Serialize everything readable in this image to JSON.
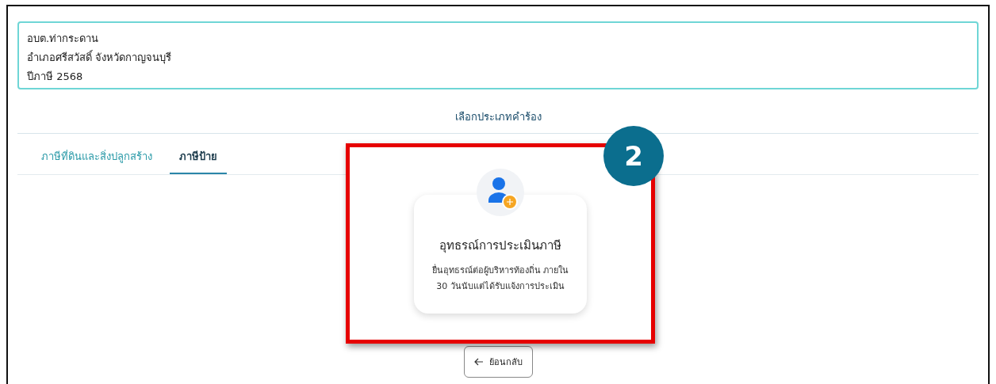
{
  "info": {
    "lines": [
      "อบต.ท่ากระดาน",
      "อำเภอศรีสวัสดิ์ จังหวัดกาญจนบุรี",
      "ปีภาษี 2568"
    ]
  },
  "section_title": "เลือกประเภทคำร้อง",
  "tabs": [
    {
      "label": "ภาษีที่ดินและสิ่งปลูกสร้าง",
      "selected": false
    },
    {
      "label": "ภาษีป้าย",
      "selected": true
    }
  ],
  "highlight": {
    "step": "2",
    "card": {
      "title": "อุทธรณ์การประเมินภาษี",
      "description": "ยื่นอุทธรณ์ต่อผู้บริหารท้องถิ่น ภายใน 30 วันนับแต่ได้รับแจ้งการประเมิน"
    }
  },
  "back_button": {
    "label": "ย้อนกลับ"
  }
}
